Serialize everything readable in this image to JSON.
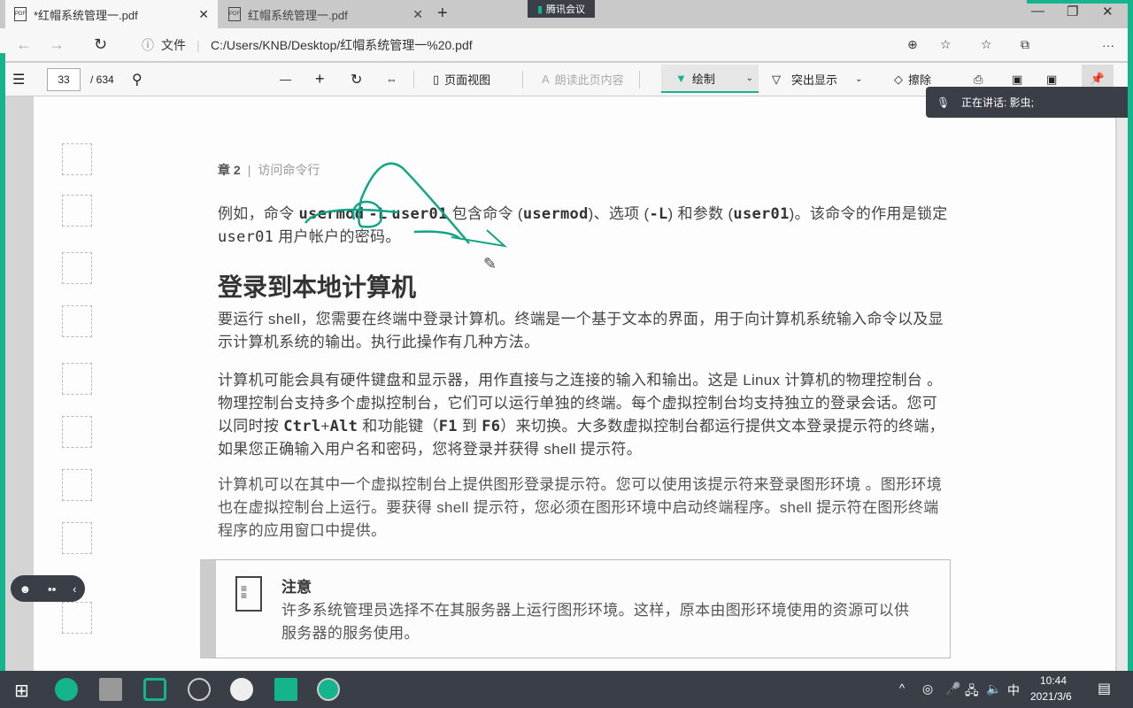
{
  "tabs": [
    {
      "title": "*红帽系统管理一.pdf",
      "active": true
    },
    {
      "title": "红帽系统管理一.pdf",
      "active": false
    }
  ],
  "meeting_label": "腾讯会议",
  "address": {
    "scheme_label": "文件",
    "url": "C:/Users/KNB/Desktop/红帽系统管理一%20.pdf"
  },
  "toolbar": {
    "page_current": "33",
    "page_total": "/ 634",
    "page_view": "页面视图",
    "read_aloud": "朗读此页内容",
    "draw": "绘制",
    "highlight": "突出显示",
    "erase": "擦除"
  },
  "speaking": "正在讲话: 影虫;",
  "doc": {
    "chapter": "章 2",
    "chapter_title": "访问命令行",
    "p1_a": "例如，命令 ",
    "cmd": "usermod",
    "opt": "-L",
    "arg": "user01",
    "p1_b": " 包含命令 (",
    "p1_c": ")、选项 (",
    "p1_d": ") 和参数 (",
    "p1_e": ")。该命令的作用是锁定 ",
    "p1_f": " 用户帐户的密码。",
    "heading": "登录到本地计算机",
    "p2": "要运行 shell，您需要在终端中登录计算机。终端是一个基于文本的界面，用于向计算机系统输入命令以及显示计算机系统的输出。执行此操作有几种方法。",
    "p3_a": "计算机可能会具有硬件键盘和显示器，用作直接与之连接的输入和输出。这是 Linux 计算机的物理控制台 。物理控制台支持多个虚拟控制台，它们可以运行单独的终端。每个虚拟控制台均支持独立的登录会话。您可以同时按 ",
    "ctrl": "Ctrl",
    "plus": "+",
    "alt": "Alt",
    "p3_b": " 和功能键（",
    "f1": "F1",
    "to": " 到 ",
    "f6": "F6",
    "p3_c": "）来切换。大多数虚拟控制台都运行提供文本登录提示符的终端，如果您正确输入用户名和密码，您将登录并获得 shell 提示符。",
    "p4": "计算机可以在其中一个虚拟控制台上提供图形登录提示符。您可以使用该提示符来登录图形环境 。图形环境也在虚拟控制台上运行。要获得 shell 提示符，您必须在图形环境中启动终端程序。shell 提示符在图形终端程序的应用窗口中提供。",
    "note_title": "注意",
    "note_body": "许多系统管理员选择不在其服务器上运行图形环境。这样，原本由图形环境使用的资源可以供服务器的服务使用。"
  },
  "tray": {
    "ime": "中",
    "time": "10:44",
    "date": "2021/3/6"
  },
  "colors": {
    "accent": "#14b48c",
    "taskbar": "#3a3f47"
  }
}
